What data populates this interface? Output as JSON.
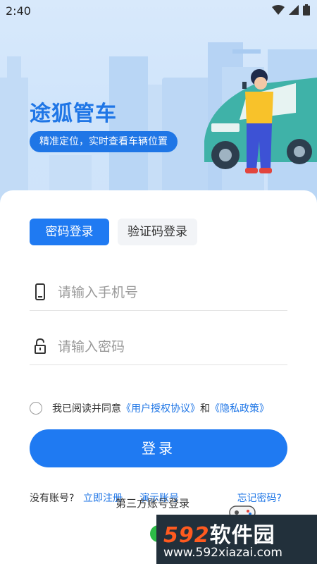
{
  "status_bar": {
    "time": "2:40"
  },
  "hero": {
    "app_title": "途狐管车",
    "slogan": "精准定位，实时查看车辆位置"
  },
  "login": {
    "tabs": [
      {
        "label": "密码登录",
        "active": true
      },
      {
        "label": "验证码登录",
        "active": false
      }
    ],
    "phone_placeholder": "请输入手机号",
    "password_placeholder": "请输入密码",
    "agreement": {
      "prefix": "我已阅读并同意",
      "user_agreement": "《用户授权协议》",
      "conjunction": "和",
      "privacy_policy": "《隐私政策》",
      "checked": false
    },
    "login_button": "登录",
    "no_account": "没有账号?",
    "register": "立即注册",
    "demo_account": "演示账号",
    "forgot_password": "忘记密码?",
    "third_party": "第三方账号登录"
  },
  "watermark": {
    "brand_number": "592",
    "brand_text": "软件园",
    "url": "www.592xiazai.com"
  },
  "colors": {
    "primary": "#1f7af2",
    "title_blue": "#1f76e6",
    "hero_bg": "#d6e8fb",
    "car_teal": "#3fb2a8"
  }
}
